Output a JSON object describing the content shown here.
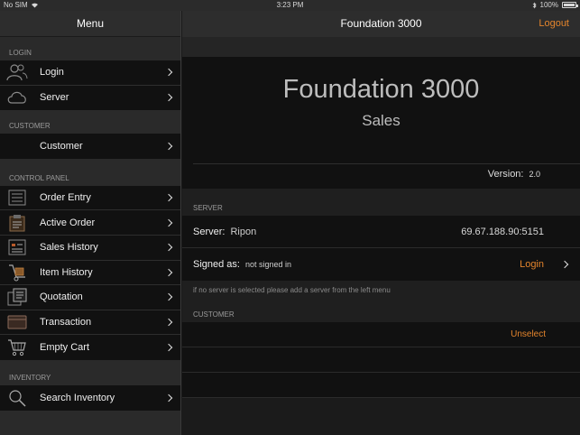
{
  "status_bar": {
    "carrier": "No SIM",
    "time": "3:23 PM",
    "battery": "100%"
  },
  "sidebar": {
    "title": "Menu",
    "sections": [
      {
        "header": "LOGIN",
        "items": [
          {
            "label": "Login",
            "icon": "users-icon"
          },
          {
            "label": "Server",
            "icon": "cloud-icon"
          }
        ]
      },
      {
        "header": "CUSTOMER",
        "items": [
          {
            "label": "Customer",
            "icon": "customer-icon"
          }
        ]
      },
      {
        "header": "CONTROL PANEL",
        "items": [
          {
            "label": "Order Entry",
            "icon": "order-entry-icon"
          },
          {
            "label": "Active Order",
            "icon": "clipboard-icon"
          },
          {
            "label": "Sales History",
            "icon": "sales-history-icon"
          },
          {
            "label": "Item History",
            "icon": "hand-truck-icon"
          },
          {
            "label": "Quotation",
            "icon": "quotation-icon"
          },
          {
            "label": "Transaction",
            "icon": "transaction-icon"
          },
          {
            "label": "Empty Cart",
            "icon": "cart-icon"
          }
        ]
      },
      {
        "header": "INVENTORY",
        "items": [
          {
            "label": "Search Inventory",
            "icon": "search-icon"
          }
        ]
      }
    ]
  },
  "main": {
    "title": "Foundation 3000",
    "logout": "Logout",
    "app_name": "Foundation 3000",
    "subtitle": "Sales",
    "version_label": "Version:",
    "version_value": "2.0",
    "server_header": "SERVER",
    "server_label": "Server:",
    "server_name": "Ripon",
    "server_address": "69.67.188.90:5151",
    "signed_label": "Signed as:",
    "signed_value": "not signed in",
    "login_link": "Login",
    "footnote": "if no server is selected please add a server from the left menu",
    "customer_header": "CUSTOMER",
    "unselect": "Unselect"
  },
  "colors": {
    "accent": "#e3842c",
    "background": "#1b1b1b",
    "row": "#111111"
  }
}
